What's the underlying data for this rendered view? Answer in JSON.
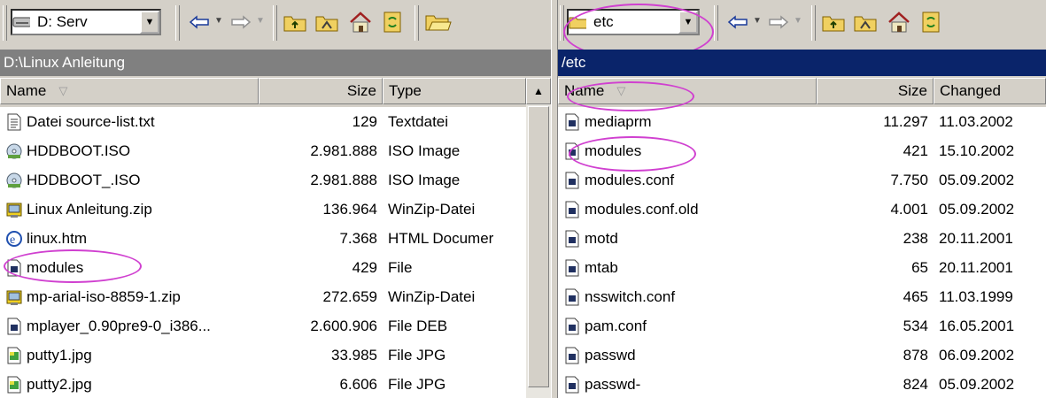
{
  "colors": {
    "annotation": "#d040d0",
    "active_path": "#0a246a",
    "inactive_path": "#808080"
  },
  "left": {
    "drive_combo": "D: Serv",
    "path": "D:\\Linux Anleitung",
    "columns": {
      "name": "Name",
      "size": "Size",
      "type": "Type"
    },
    "files": [
      {
        "icon": "text-file-icon",
        "name": "Datei source-list.txt",
        "size": "129",
        "type": "Textdatei"
      },
      {
        "icon": "iso-disc-icon",
        "name": "HDDBOOT.ISO",
        "size": "2.981.888",
        "type": "ISO Image"
      },
      {
        "icon": "iso-disc-icon",
        "name": "HDDBOOT_.ISO",
        "size": "2.981.888",
        "type": "ISO Image"
      },
      {
        "icon": "zip-archive-icon",
        "name": "Linux Anleitung.zip",
        "size": "136.964",
        "type": "WinZip-Datei"
      },
      {
        "icon": "html-document-icon",
        "name": "linux.htm",
        "size": "7.368",
        "type": "HTML Documer"
      },
      {
        "icon": "generic-file-icon",
        "name": "modules",
        "size": "429",
        "type": "File"
      },
      {
        "icon": "zip-archive-icon",
        "name": "mp-arial-iso-8859-1.zip",
        "size": "272.659",
        "type": "WinZip-Datei"
      },
      {
        "icon": "generic-file-icon",
        "name": "mplayer_0.90pre9-0_i386...",
        "size": "2.600.906",
        "type": "File DEB"
      },
      {
        "icon": "image-file-icon",
        "name": "putty1.jpg",
        "size": "33.985",
        "type": "File JPG"
      },
      {
        "icon": "image-file-icon",
        "name": "putty2.jpg",
        "size": "6.606",
        "type": "File JPG"
      }
    ]
  },
  "right": {
    "folder_combo": "etc",
    "path": "/etc",
    "columns": {
      "name": "Name",
      "size": "Size",
      "changed": "Changed"
    },
    "files": [
      {
        "name": "mediaprm",
        "size": "11.297",
        "changed": "11.03.2002"
      },
      {
        "name": "modules",
        "size": "421",
        "changed": "15.10.2002"
      },
      {
        "name": "modules.conf",
        "size": "7.750",
        "changed": "05.09.2002"
      },
      {
        "name": "modules.conf.old",
        "size": "4.001",
        "changed": "05.09.2002"
      },
      {
        "name": "motd",
        "size": "238",
        "changed": "20.11.2001"
      },
      {
        "name": "mtab",
        "size": "65",
        "changed": "20.11.2001"
      },
      {
        "name": "nsswitch.conf",
        "size": "465",
        "changed": "11.03.1999"
      },
      {
        "name": "pam.conf",
        "size": "534",
        "changed": "16.05.2001"
      },
      {
        "name": "passwd",
        "size": "878",
        "changed": "06.09.2002"
      },
      {
        "name": "passwd-",
        "size": "824",
        "changed": "05.09.2002"
      }
    ]
  }
}
